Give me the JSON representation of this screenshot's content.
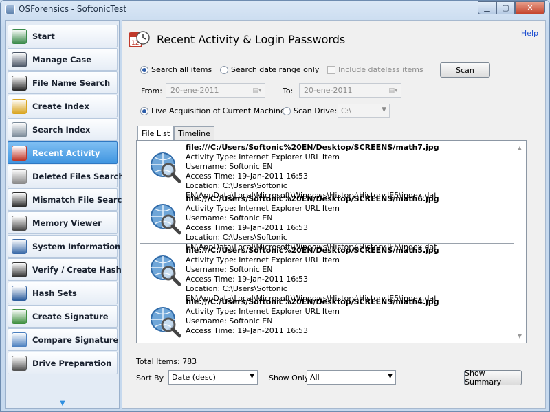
{
  "window": {
    "title": "OSForensics - SoftonicTest"
  },
  "sidebar": {
    "items": [
      {
        "label": "Start",
        "icon": "start-icon",
        "color": "#3a8a4a"
      },
      {
        "label": "Manage Case",
        "icon": "briefcase-icon",
        "color": "#4a5566"
      },
      {
        "label": "File Name Search",
        "icon": "binoculars-icon",
        "color": "#2b2b2b"
      },
      {
        "label": "Create Index",
        "icon": "pencil-icon",
        "color": "#d9a520"
      },
      {
        "label": "Search Index",
        "icon": "magnifier-icon",
        "color": "#7a8a99"
      },
      {
        "label": "Recent Activity",
        "icon": "calendar-clock-icon",
        "color": "#c0392b"
      },
      {
        "label": "Deleted Files Search",
        "icon": "deleted-files-icon",
        "color": "#8a8a8a"
      },
      {
        "label": "Mismatch File Search",
        "icon": "binoculars-icon",
        "color": "#2b2b2b"
      },
      {
        "label": "Memory Viewer",
        "icon": "eye-icon",
        "color": "#4a4a4a"
      },
      {
        "label": "System Information",
        "icon": "computer-icon",
        "color": "#3a6aa8"
      },
      {
        "label": "Verify / Create Hash",
        "icon": "barcode-icon",
        "color": "#333333"
      },
      {
        "label": "Hash Sets",
        "icon": "hash-sets-icon",
        "color": "#2f5f9f"
      },
      {
        "label": "Create Signature",
        "icon": "signature-icon",
        "color": "#3f8f3f"
      },
      {
        "label": "Compare Signature",
        "icon": "compare-icon",
        "color": "#4a7fbf"
      },
      {
        "label": "Drive Preparation",
        "icon": "drive-icon",
        "color": "#555555"
      }
    ],
    "active_index": 5
  },
  "header": {
    "title": "Recent Activity & Login Passwords",
    "help": "Help"
  },
  "filters": {
    "search_all": "Search all items",
    "search_range": "Search date range only",
    "include_dateless": "Include dateless items",
    "scan_button": "Scan",
    "from_label": "From:",
    "from_value": "20-ene-2011",
    "to_label": "To:",
    "to_value": "20-ene-2011",
    "live_acquisition": "Live Acquisition of Current Machine",
    "scan_drive": "Scan Drive:",
    "drive_value": "C:\\"
  },
  "tabs": [
    "File List",
    "Timeline"
  ],
  "entries": [
    {
      "path": "file:///C:/Users/Softonic%20EN/Desktop/SCREENS/math7.jpg",
      "type": "Activity Type: Internet Explorer URL Item",
      "user": "Username: Softonic EN",
      "time": "Access Time: 19-Jan-2011 16:53",
      "location": "Location: C:\\Users\\Softonic EN\\AppData\\Local\\Microsoft\\Windows\\History\\History.IE5\\index.dat"
    },
    {
      "path": "file:///C:/Users/Softonic%20EN/Desktop/SCREENS/math6.jpg",
      "type": "Activity Type: Internet Explorer URL Item",
      "user": "Username: Softonic EN",
      "time": "Access Time: 19-Jan-2011 16:53",
      "location": "Location: C:\\Users\\Softonic EN\\AppData\\Local\\Microsoft\\Windows\\History\\History.IE5\\index.dat"
    },
    {
      "path": "file:///C:/Users/Softonic%20EN/Desktop/SCREENS/math5.jpg",
      "type": "Activity Type: Internet Explorer URL Item",
      "user": "Username: Softonic EN",
      "time": "Access Time: 19-Jan-2011 16:53",
      "location": "Location: C:\\Users\\Softonic EN\\AppData\\Local\\Microsoft\\Windows\\History\\History.IE5\\index.dat"
    },
    {
      "path": "file:///C:/Users/Softonic%20EN/Desktop/SCREENS/math4.jpg",
      "type": "Activity Type: Internet Explorer URL Item",
      "user": "Username: Softonic EN",
      "time": "Access Time: 19-Jan-2011 16:53",
      "location": ""
    }
  ],
  "footer": {
    "total": "Total Items: 783",
    "sort_label": "Sort By",
    "sort_value": "Date (desc)",
    "show_label": "Show Only",
    "show_value": "All",
    "summary_button": "Show Summary"
  }
}
